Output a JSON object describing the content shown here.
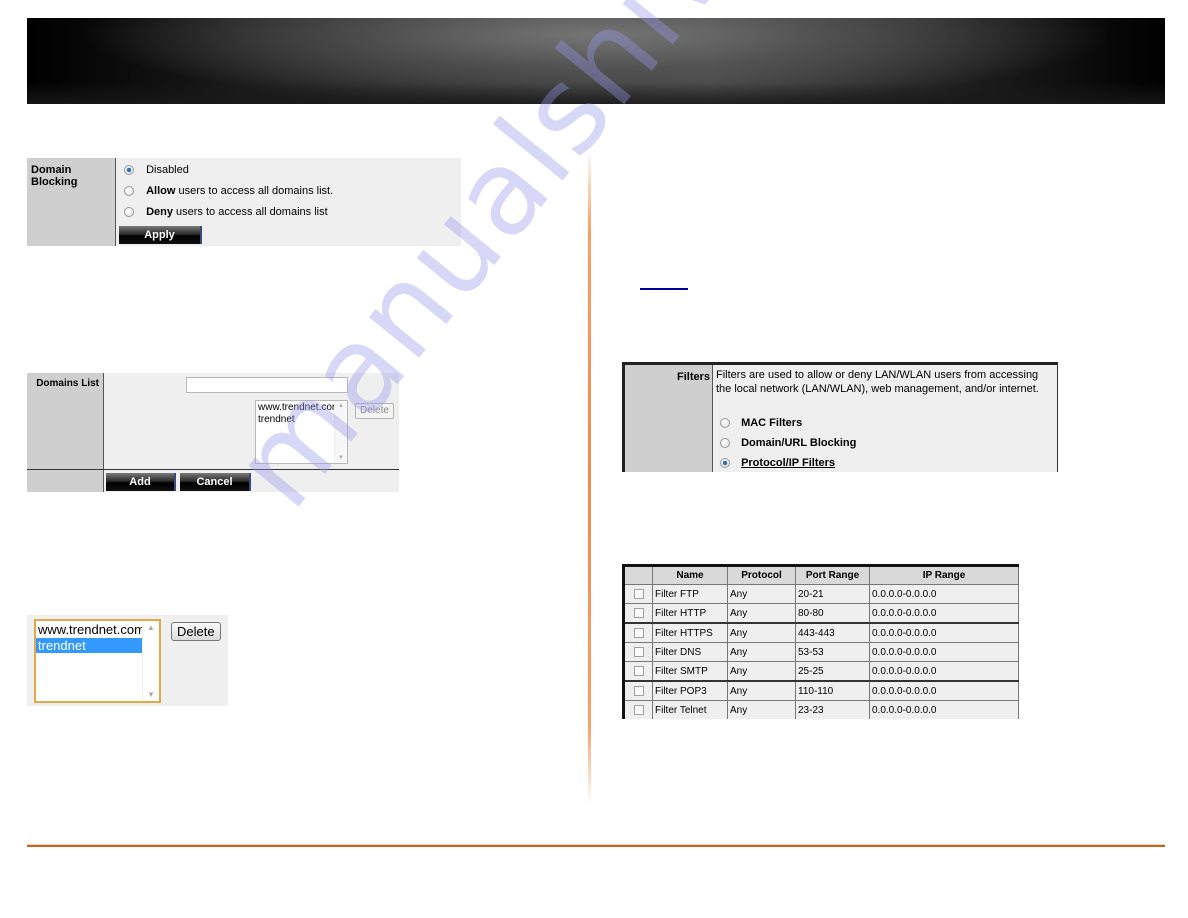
{
  "watermark": "manualshive.com",
  "domain_blocking": {
    "label": "Domain Blocking",
    "options": [
      {
        "bold": "",
        "text": "Disabled",
        "selected": true
      },
      {
        "bold": "Allow",
        "text": " users to access all domains list.",
        "selected": false
      },
      {
        "bold": "Deny",
        "text": " users to access all domains list",
        "selected": false
      }
    ],
    "apply_label": "Apply"
  },
  "domains_list": {
    "label": "Domains List",
    "input_value": "",
    "items": [
      "www.trendnet.com",
      "trendnet"
    ],
    "delete_label": "Delete",
    "add_label": "Add",
    "cancel_label": "Cancel"
  },
  "selection_example": {
    "items": [
      "www.trendnet.com",
      "trendnet"
    ],
    "selected_item": "trendnet",
    "delete_label": "Delete"
  },
  "link": {
    "text": ""
  },
  "filters_panel": {
    "label": "Filters",
    "description": "Filters are used to allow or deny LAN/WLAN users from accessing the local network (LAN/WLAN), web management, and/or internet.",
    "options": [
      {
        "label": "MAC Filters",
        "selected": false
      },
      {
        "label": "Domain/URL Blocking",
        "selected": false
      },
      {
        "label": "Protocol/IP Filters",
        "selected": true
      }
    ]
  },
  "filter_table": {
    "columns": [
      "",
      "Name",
      "Protocol",
      "Port Range",
      "IP Range"
    ],
    "rows": [
      {
        "name": "Filter FTP",
        "protocol": "Any",
        "port_range": "20-21",
        "ip_range": "0.0.0.0-0.0.0.0",
        "checked": false
      },
      {
        "name": "Filter HTTP",
        "protocol": "Any",
        "port_range": "80-80",
        "ip_range": "0.0.0.0-0.0.0.0",
        "checked": false
      },
      {
        "name": "Filter HTTPS",
        "protocol": "Any",
        "port_range": "443-443",
        "ip_range": "0.0.0.0-0.0.0.0",
        "checked": false
      },
      {
        "name": "Filter DNS",
        "protocol": "Any",
        "port_range": "53-53",
        "ip_range": "0.0.0.0-0.0.0.0",
        "checked": false
      },
      {
        "name": "Filter SMTP",
        "protocol": "Any",
        "port_range": "25-25",
        "ip_range": "0.0.0.0-0.0.0.0",
        "checked": false
      },
      {
        "name": "Filter POP3",
        "protocol": "Any",
        "port_range": "110-110",
        "ip_range": "0.0.0.0-0.0.0.0",
        "checked": false
      },
      {
        "name": "Filter Telnet",
        "protocol": "Any",
        "port_range": "23-23",
        "ip_range": "0.0.0.0-0.0.0.0",
        "checked": false
      }
    ]
  },
  "colors": {
    "accent_orange": "#c0652a",
    "selection_blue": "#3399ff",
    "link_blue": "#000099",
    "focus_border": "#e3a84a"
  }
}
